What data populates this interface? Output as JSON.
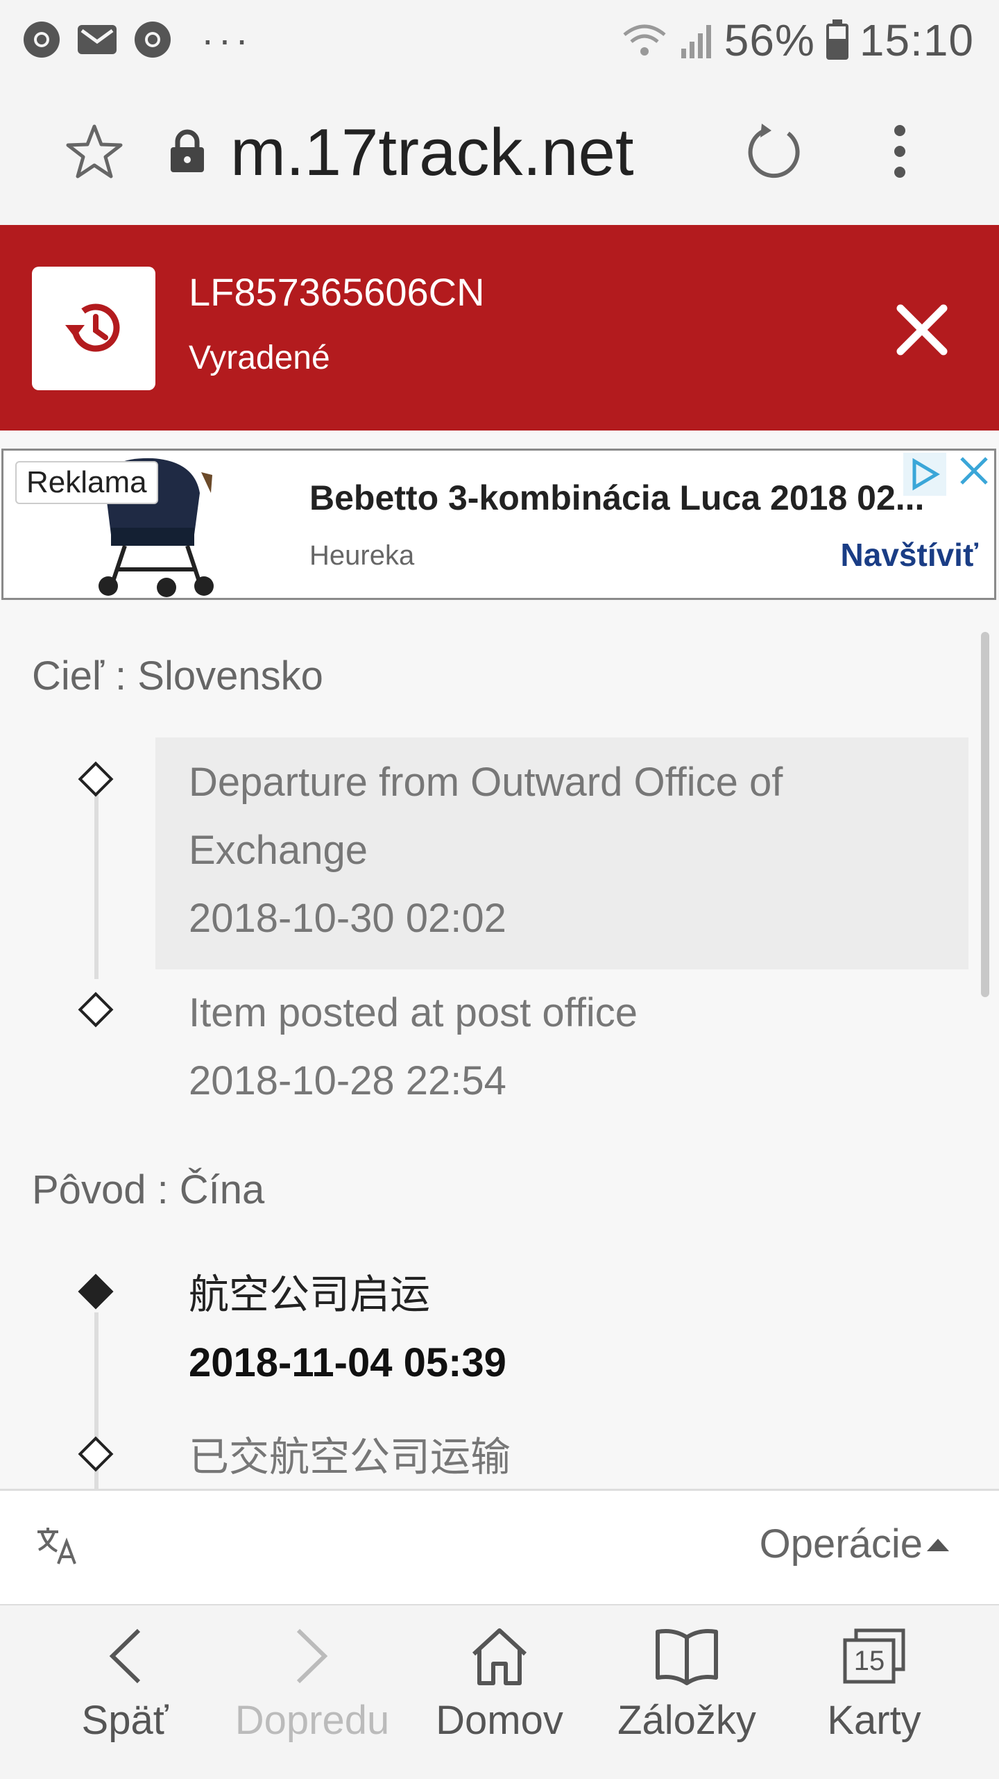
{
  "status_bar": {
    "battery": "56%",
    "time": "15:10",
    "more": "···"
  },
  "browser": {
    "url": "m.17track.net"
  },
  "banner": {
    "tracking_number": "LF857365606CN",
    "status": "Vyradené"
  },
  "ad": {
    "label": "Reklama",
    "title": "Bebetto 3-kombinácia Luca 2018 02...",
    "source": "Heureka",
    "cta": "Navštíviť"
  },
  "destination": {
    "label": "Cieľ : Slovensko",
    "events": [
      {
        "line1": "Departure from Outward Office of",
        "line2": "Exchange",
        "time": "2018-10-30 02:02"
      },
      {
        "line1": "Item posted at post office",
        "time": "2018-10-28 22:54"
      }
    ]
  },
  "origin": {
    "label": "Pôvod : Čína",
    "events": [
      {
        "text": "航空公司启运",
        "time": "2018-11-04 05:39"
      },
      {
        "text": "已交航空公司运输"
      }
    ]
  },
  "toolbar": {
    "operations": "Operácie"
  },
  "nav": {
    "back": "Späť",
    "forward": "Dopredu",
    "home": "Domov",
    "bookmarks": "Záložky",
    "tabs": "Karty",
    "tabs_count": "15"
  },
  "colors": {
    "banner": "#b31b1e",
    "ad_cta": "#1a3d85",
    "highlight": "#ececec"
  }
}
